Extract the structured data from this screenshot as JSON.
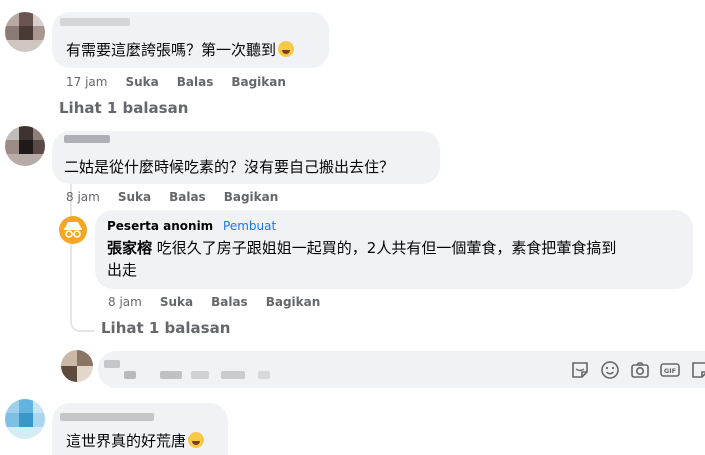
{
  "comments": [
    {
      "text": "有需要這麼誇張嗎？第一次聽到",
      "emoji": "laughing-emoji",
      "time": "17 jam",
      "like": "Suka",
      "reply": "Balas",
      "share": "Bagikan",
      "replies_link": "Lihat 1 balasan"
    },
    {
      "text": "二姑是從什麼時候吃素的？沒有要自己搬出去住？",
      "time": "8 jam",
      "like": "Suka",
      "reply": "Balas",
      "share": "Bagikan",
      "reply_item": {
        "author": "Peserta anonim",
        "badge": "Pembuat",
        "mention": "張家榕",
        "text_line1": " 吃很久了房子跟姐姐一起買的，2人共有但一個葷食，素食把葷食搞到",
        "text_line2": "出走",
        "time": "8 jam",
        "like": "Suka",
        "reply": "Balas",
        "share": "Bagikan"
      },
      "replies_link": "Lihat 1 balasan"
    },
    {
      "text": "這世界真的好荒唐",
      "emoji": "laughing-emoji"
    }
  ],
  "composer": {
    "icons": [
      "sticker-icon",
      "emoji-icon",
      "camera-icon",
      "gif-icon",
      "sticker-alt-icon"
    ],
    "gif_label": "GIF"
  }
}
